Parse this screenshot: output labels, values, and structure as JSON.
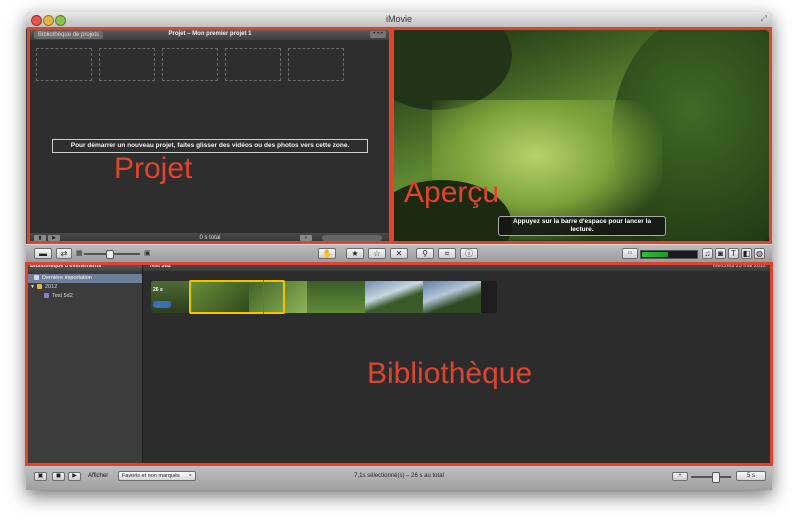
{
  "window": {
    "title": "iMovie"
  },
  "project": {
    "library_tab": "Bibliothèque de projets",
    "title": "Projet – Mon premier projet 1",
    "drop_message": "Pour démarrer un nouveau projet, faites glisser des vidéos ou des photos vers cette zone.",
    "total": "0 s total"
  },
  "preview": {
    "tooltip_line1": "Appuyez sur la barre d'espace pour lancer la",
    "tooltip_line2": "lecture."
  },
  "events": {
    "header": "Bibliothèque d'événements",
    "items": [
      {
        "label": "Dernière importation",
        "selected": true
      },
      {
        "label": "2012",
        "selected": false
      },
      {
        "label": "Test 5d2",
        "selected": false
      }
    ]
  },
  "browser": {
    "event_title": "Test 5d2",
    "date": "mercredi 23 mai 2012",
    "clip_badge": "26 s"
  },
  "bottombar": {
    "show_label": "Afficher",
    "filter_value": "Favoris et non marqués",
    "status": "7,1s sélectionné(s) – 26 s au total",
    "duration": "5 s"
  },
  "annotations": {
    "project": "Projet",
    "preview": "Aperçu",
    "library": "Bibliothèque"
  },
  "colors": {
    "annotation": "#e0432e",
    "selection": "#f2c200",
    "audio_meter": "#2fbf3a"
  },
  "icons": [
    "camera-icon",
    "swap-icon",
    "thumbnail-icon",
    "hand-icon",
    "star-icon",
    "star-outline-icon",
    "reject-icon",
    "key-icon",
    "crop-icon",
    "info-icon",
    "music-icon",
    "photo-icon",
    "title-icon",
    "transition-icon",
    "globe-icon",
    "play-icon",
    "fullscreen-icon",
    "voiceover-icon",
    "zoom-icon"
  ]
}
